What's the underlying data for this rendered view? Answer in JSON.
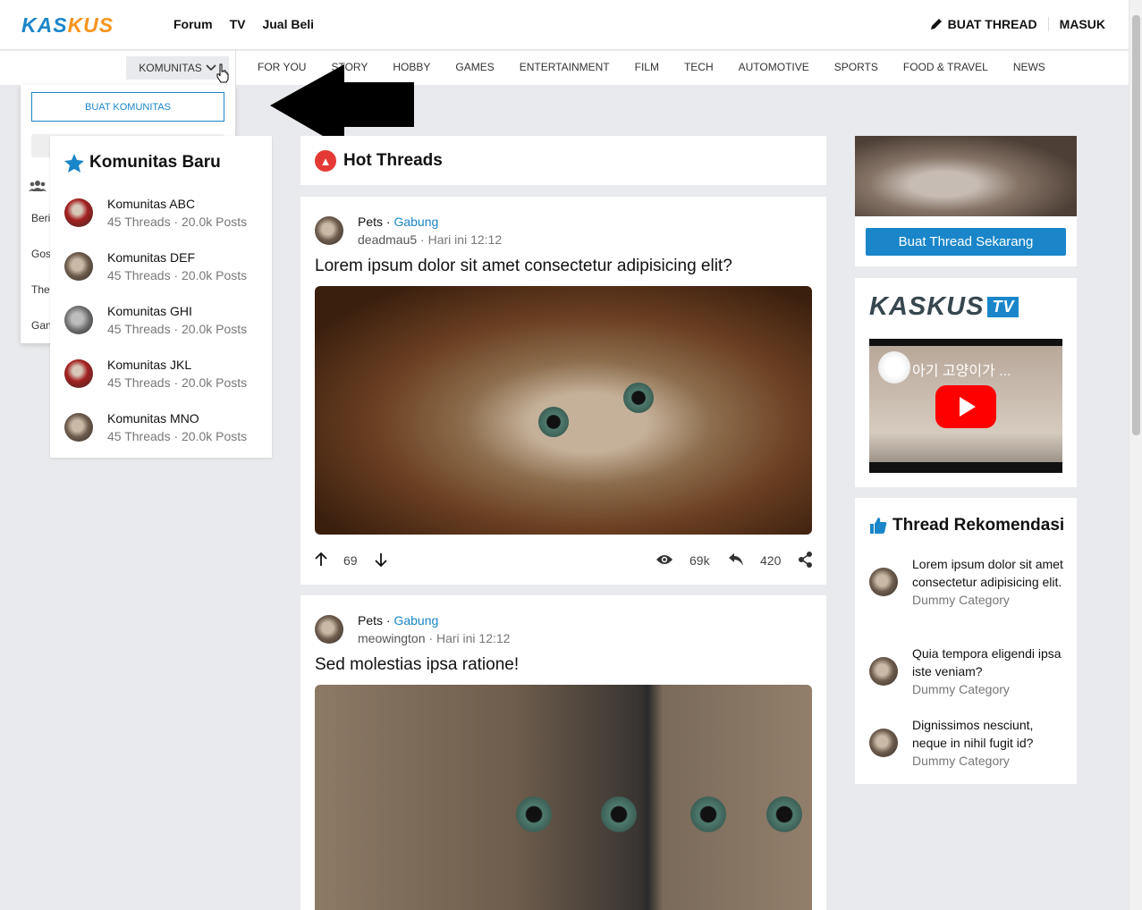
{
  "header": {
    "logo_part1": "KAS",
    "logo_part2": "KUS",
    "nav": [
      "Forum",
      "TV",
      "Jual Beli"
    ],
    "buat_thread": "BUAT THREAD",
    "masuk": "MASUK"
  },
  "catbar": {
    "komunitas": "KOMUNITAS",
    "categories": [
      "FOR YOU",
      "STORY",
      "HOBBY",
      "GAMES",
      "ENTERTAINMENT",
      "FILM",
      "TECH",
      "AUTOMOTIVE",
      "SPORTS",
      "FOOD & TRAVEL",
      "NEWS"
    ]
  },
  "dropdown": {
    "buat_komunitas": "BUAT KOMUNITAS",
    "items": [
      "Beri",
      "Gos",
      "The",
      "Gan"
    ]
  },
  "komunitas_baru": {
    "title": "Komunitas Baru",
    "items": [
      {
        "name": "Komunitas ABC",
        "meta": "45 Threads · 20.0k Posts"
      },
      {
        "name": "Komunitas DEF",
        "meta": "45 Threads · 20.0k Posts"
      },
      {
        "name": "Komunitas GHI",
        "meta": "45 Threads · 20.0k Posts"
      },
      {
        "name": "Komunitas JKL",
        "meta": "45 Threads · 20.0k Posts"
      },
      {
        "name": "Komunitas MNO",
        "meta": "45 Threads · 20.0k Posts"
      }
    ]
  },
  "hot": {
    "title": "Hot Threads"
  },
  "posts": [
    {
      "category": "Pets",
      "join": "Gabung",
      "user": "deadmau5",
      "time": "Hari ini 12:12",
      "title": "Lorem ipsum dolor sit amet consectetur adipisicing elit?",
      "votes": "69",
      "views": "69k",
      "replies": "420"
    },
    {
      "category": "Pets",
      "join": "Gabung",
      "user": "meowington",
      "time": "Hari ini 12:12",
      "title": "Sed molestias ipsa ratione!"
    }
  ],
  "right": {
    "cta": "Buat Thread Sekarang",
    "ktv_logo": "KASKUS",
    "ktv_badge": "TV",
    "video_title": "아기 고양이가 ...",
    "rekomendasi_title": "Thread Rekomendasi",
    "rekomendasi": [
      {
        "title": "Lorem ipsum dolor sit amet consectetur adipisicing elit.",
        "category": "Dummy Category"
      },
      {
        "title": "Quia tempora eligendi ipsa iste veniam?",
        "category": "Dummy Category"
      },
      {
        "title": "Dignissimos nesciunt, neque in nihil fugit id?",
        "category": "Dummy Category"
      }
    ]
  }
}
